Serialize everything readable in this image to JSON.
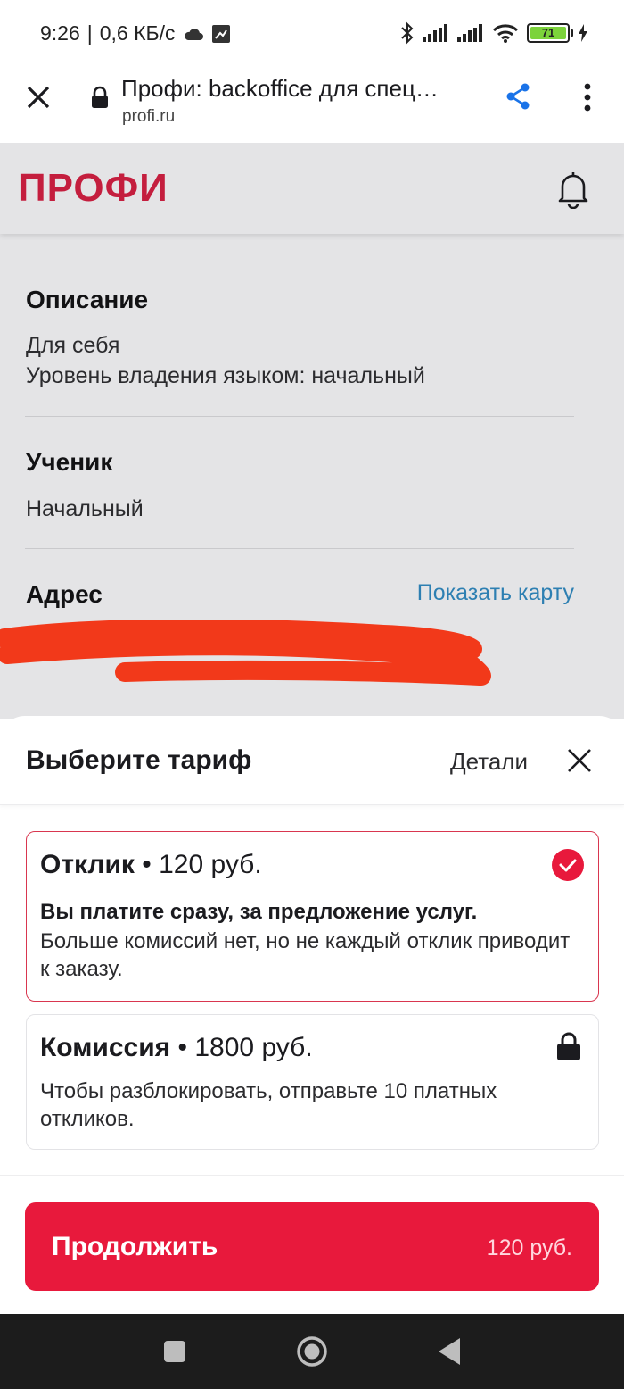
{
  "status_bar": {
    "time": "9:26",
    "speed": "0,6 КБ/с",
    "battery": "71"
  },
  "browser": {
    "title": "Профи: backoffice для спец…",
    "domain": "profi.ru"
  },
  "site": {
    "logo": "ПРОФИ"
  },
  "sections": {
    "description": {
      "title": "Описание",
      "lines": [
        "Для себя",
        "Уровень владения языком: начальный"
      ]
    },
    "student": {
      "title": "Ученик",
      "value": "Начальный"
    },
    "address": {
      "title": "Адрес",
      "map_link": "Показать карту"
    }
  },
  "sheet": {
    "title": "Выберите тариф",
    "details": "Детали",
    "tariffs": [
      {
        "name": "Отклик",
        "price": " • 120 руб.",
        "bold_text": "Вы платите сразу, за предложение услуг.",
        "description": "Больше комиссий нет, но не каждый отклик приводит к заказу.",
        "selected": true
      },
      {
        "name": "Комиссия",
        "price": " • 1800 руб.",
        "description": "Чтобы разблокировать, отправьте 10 платных откликов.",
        "locked": true
      }
    ],
    "cta": {
      "label": "Продолжить",
      "price": "120 руб."
    }
  },
  "colors": {
    "brand": "#c41e3e",
    "cta": "#e8193c",
    "link": "#2d7fb2"
  }
}
